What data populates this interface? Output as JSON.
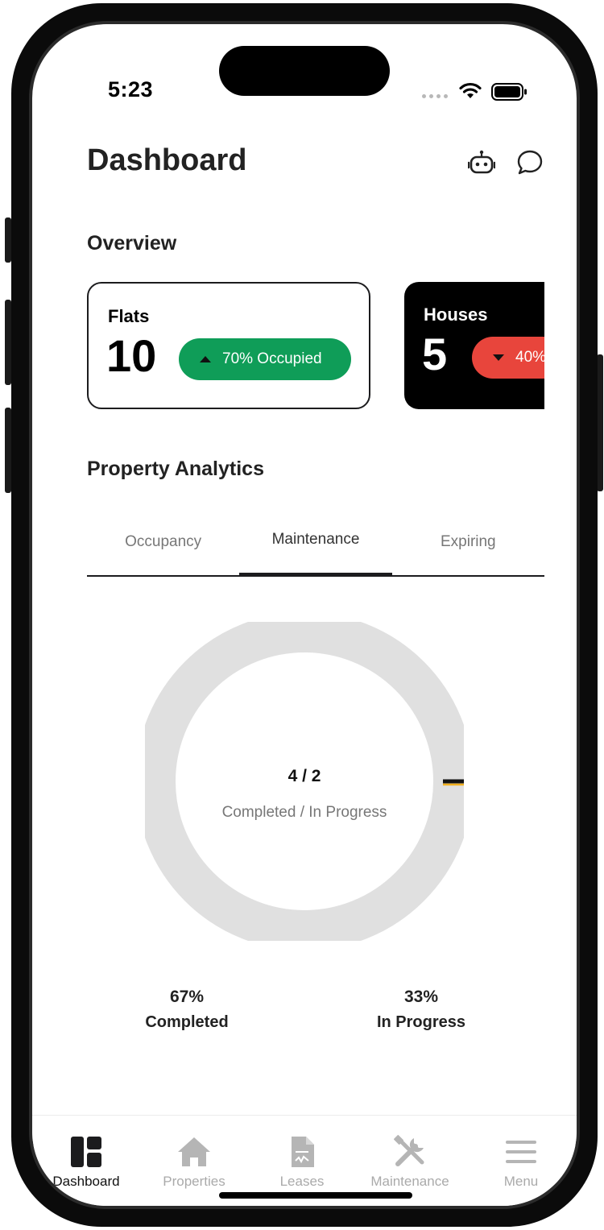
{
  "status_bar": {
    "time": "5:23"
  },
  "header": {
    "title": "Dashboard"
  },
  "overview": {
    "title": "Overview",
    "cards": [
      {
        "label": "Flats",
        "count": "10",
        "badge": "70% Occupied",
        "trend": "up",
        "badge_color": "#0f9d58"
      },
      {
        "label": "Houses",
        "count": "5",
        "badge": "40%",
        "trend": "down",
        "badge_color": "#e8453c"
      }
    ]
  },
  "analytics": {
    "title": "Property Analytics",
    "tabs": [
      {
        "label": "Occupancy",
        "active": false
      },
      {
        "label": "Maintenance",
        "active": true
      },
      {
        "label": "Expiring",
        "active": false
      }
    ],
    "donut": {
      "value": "4 / 2",
      "caption": "Completed / In Progress",
      "track_color": "#e0e0e0",
      "accent_color": "#f2b01e"
    },
    "legend": [
      {
        "pct": "67%",
        "label": "Completed"
      },
      {
        "pct": "33%",
        "label": "In Progress"
      }
    ]
  },
  "bottom_nav": [
    {
      "label": "Dashboard",
      "icon": "dashboard-icon",
      "active": true
    },
    {
      "label": "Properties",
      "icon": "home-icon",
      "active": false
    },
    {
      "label": "Leases",
      "icon": "document-icon",
      "active": false
    },
    {
      "label": "Maintenance",
      "icon": "tools-icon",
      "active": false
    },
    {
      "label": "Menu",
      "icon": "menu-icon",
      "active": false
    }
  ]
}
